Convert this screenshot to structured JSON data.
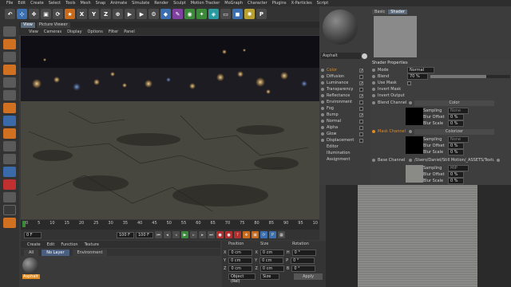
{
  "menubar": [
    "File",
    "Edit",
    "Create",
    "Select",
    "Tools",
    "Mesh",
    "Snap",
    "Animate",
    "Simulate",
    "Render",
    "Sculpt",
    "Motion Tracker",
    "MoGraph",
    "Character",
    "Plugins",
    "X-Particles",
    "Script"
  ],
  "toolbar": {
    "x": "X",
    "y": "Y",
    "z": "Z",
    "p": "P"
  },
  "viewport": {
    "tabs": [
      "View",
      "Picture Viewer"
    ],
    "menu": [
      "View",
      "Cameras",
      "Display",
      "Options",
      "Filter",
      "Panel"
    ]
  },
  "timeline": {
    "ticks": [
      "0",
      "5",
      "10",
      "15",
      "20",
      "25",
      "30",
      "35",
      "40",
      "45",
      "50",
      "55",
      "60",
      "65",
      "70",
      "75",
      "80",
      "85",
      "90",
      "95",
      "10"
    ],
    "frame_label": "0 F",
    "current": "0 F",
    "end": "100 F",
    "end2": "100 F"
  },
  "material_manager": {
    "menu": [
      "Create",
      "Edit",
      "Function",
      "Texture"
    ],
    "filters": [
      "All",
      "No Layer",
      "Environment"
    ],
    "material_name": "Asphalt"
  },
  "coords": {
    "headers": [
      "Position",
      "Size",
      "Rotation"
    ],
    "rows": [
      {
        "axis": "X",
        "pos": "0 cm",
        "size_axis": "X",
        "size": "0 cm",
        "rot_axis": "H",
        "rot": "0 °"
      },
      {
        "axis": "Y",
        "pos": "0 cm",
        "size_axis": "Y",
        "size": "0 cm",
        "rot_axis": "P",
        "rot": "0 °"
      },
      {
        "axis": "Z",
        "pos": "0 cm",
        "size_axis": "Z",
        "size": "0 cm",
        "rot_axis": "B",
        "rot": "0 °"
      }
    ],
    "mode": "Object (Rel)",
    "size_mode": "Size",
    "apply": "Apply"
  },
  "attributes": {
    "material_name": "Asphalt",
    "tabs": [
      "Basic",
      "Shader"
    ],
    "channels": [
      {
        "label": "Color",
        "checked": true,
        "highlight": true
      },
      {
        "label": "Diffusion",
        "checked": false
      },
      {
        "label": "Luminance",
        "checked": true
      },
      {
        "label": "Transparency",
        "checked": false
      },
      {
        "label": "Reflectance",
        "checked": true
      },
      {
        "label": "Environment",
        "checked": false
      },
      {
        "label": "Fog",
        "checked": false
      },
      {
        "label": "Bump",
        "checked": true
      },
      {
        "label": "Normal",
        "checked": false
      },
      {
        "label": "Alpha",
        "checked": false
      },
      {
        "label": "Glow",
        "checked": false
      },
      {
        "label": "Displacement",
        "checked": false
      },
      {
        "label": "Editor",
        "checked": null
      },
      {
        "label": "Illumination",
        "checked": null
      },
      {
        "label": "Assignment",
        "checked": null
      }
    ],
    "shader_props_title": "Shader Properties",
    "mode_label": "Mode",
    "mode_value": "Normal",
    "blend_label": "Blend",
    "blend_value": "70 %",
    "blend_fraction": 0.7,
    "use_mask": "Use Mask",
    "invert_mask": "Invert Mask",
    "invert_output": "Invert Output",
    "blend_channel": "Blend Channel",
    "blend_channel_type": "Color",
    "sampling": "Sampling",
    "sampling_value": "None",
    "sampling_value_mip": "MIP",
    "blur_offset": "Blur Offset",
    "blur_scale": "Blur Scale",
    "zero_pct": "0 %",
    "mask_channel": "Mask Channel",
    "mask_channel_type": "Colorizer",
    "base_channel": "Base Channel",
    "base_path": "/Users/Daniel/Still Motion/_ASSETS/Textures/Asph"
  },
  "colors": {
    "accent": "#e08a20",
    "bg": "#3c3c3c",
    "selection": "#4a5e80"
  }
}
